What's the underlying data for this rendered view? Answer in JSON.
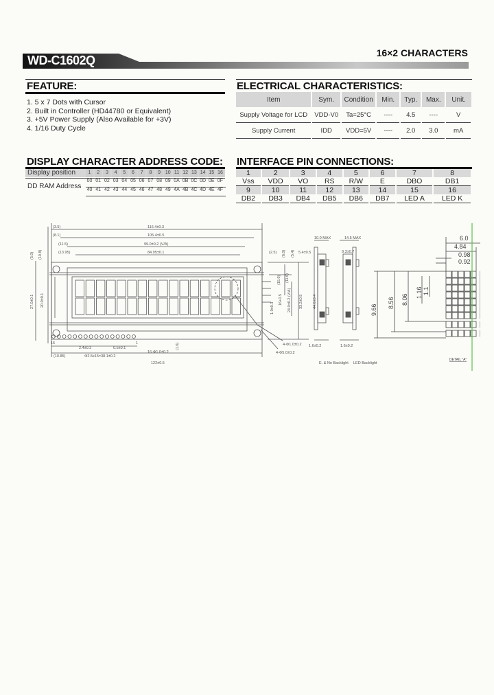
{
  "header": {
    "model": "WD-C1602Q",
    "subtitle": "16×2  CHARACTERS"
  },
  "feature": {
    "title": "FEATURE:",
    "items": [
      "1. 5 x 7 Dots with Cursor",
      "2. Built in Controller (HD44780 or Equivalent)",
      "3. +5V Power Supply (Also Available for +3V)",
      "4. 1/16 Duty Cycle"
    ]
  },
  "electrical": {
    "title": "ELECTRICAL CHARACTERISTICS:",
    "columns": [
      "Item",
      "Sym.",
      "Condition",
      "Min.",
      "Typ.",
      "Max.",
      "Unit."
    ],
    "rows": [
      [
        "Supply Voltage for LCD",
        "VDD-V0",
        "Ta=25°C",
        "----",
        "4.5",
        "----",
        "V"
      ],
      [
        "Supply Current",
        "IDD",
        "VDD=5V",
        "----",
        "2.0",
        "3.0",
        "mA"
      ]
    ]
  },
  "address": {
    "title": "DISPLAY CHARACTER ADDRESS CODE:",
    "position_label": "Display position",
    "ram_label": "DD RAM Address",
    "positions": [
      "1",
      "2",
      "3",
      "4",
      "5",
      "6",
      "7",
      "8",
      "9",
      "10",
      "11",
      "12",
      "13",
      "14",
      "15",
      "16"
    ],
    "line1": [
      "00",
      "01",
      "02",
      "03",
      "04",
      "05",
      "06",
      "07",
      "08",
      "09",
      "0A",
      "0B",
      "0C",
      "0D",
      "0E",
      "0F"
    ],
    "line2": [
      "40",
      "41",
      "42",
      "43",
      "44",
      "45",
      "46",
      "47",
      "48",
      "49",
      "4A",
      "4B",
      "4C",
      "4D",
      "4E",
      "4F"
    ]
  },
  "pins": {
    "title": "INTERFACE PIN CONNECTIONS:",
    "row1_numbers": [
      "1",
      "2",
      "3",
      "4",
      "5",
      "6",
      "7",
      "8"
    ],
    "row1_names": [
      "Vss",
      "VDD",
      "VO",
      "RS",
      "R/W",
      "E",
      "DBO",
      "DB1"
    ],
    "row2_numbers": [
      "9",
      "10",
      "11",
      "12",
      "13",
      "14",
      "15",
      "16"
    ],
    "row2_names": [
      "DB2",
      "DB3",
      "DB4",
      "DB5",
      "DB6",
      "DB7",
      "LED A",
      "LED K"
    ]
  },
  "drawing": {
    "dims": {
      "d1": "(3.5)",
      "d2": "(8.1)",
      "d3": "(11.5)",
      "d4": "(13.95)",
      "w1": "116.4±0.3",
      "w2": "105.4±0.5",
      "w3": "99.0±0.2 (V/A)",
      "w4": "84.95±0.1",
      "h1": "27.0±0.1",
      "h2": "20.0±0.1",
      "h3": "(5.0)",
      "h4": "(10.8)",
      "r1": "(2.5)",
      "r2": "(6.0)",
      "r3": "(5.4)",
      "r4": "5.4±0.5",
      "r5": "(15.0)",
      "r6": "(11.6)",
      "r7": "16+0.5",
      "r8": "24.0±0.2 (V/A)",
      "r9": "33.2±0.5",
      "r10": "44.0±0.4",
      "r11": "1.0±0.3",
      "b1": "2.4±0.2",
      "b2": "0.5±0.1",
      "b3": "(10.85)",
      "b4": "Φ2.5x15=38.1±0.2",
      "b5": "16-Φ1.0±0.2",
      "b6": "122±0.5",
      "b7": "(1.6)",
      "hole1": "4-Φ1.0±0.2",
      "hole2": "4-Φ5.0±0.2",
      "pin16": "16",
      "pin1": "1",
      "side1": "10.0 MAX",
      "side2": "14.5 MAX",
      "side3": "9.3±0.7",
      "side4": "1.6±0.2",
      "side5": "1.6±0.2",
      "cap1": "E. & No Backlight",
      "cap2": "LED Backlight"
    },
    "detail": {
      "w1": "6.0",
      "w2": "4.84",
      "w3": "0.98",
      "w4": "0.92",
      "h1": "9.66",
      "h2": "8.56",
      "h3": "8.06",
      "h4": "1.16",
      "h5": "1.1",
      "caption": "DETAIL \"A\""
    }
  }
}
